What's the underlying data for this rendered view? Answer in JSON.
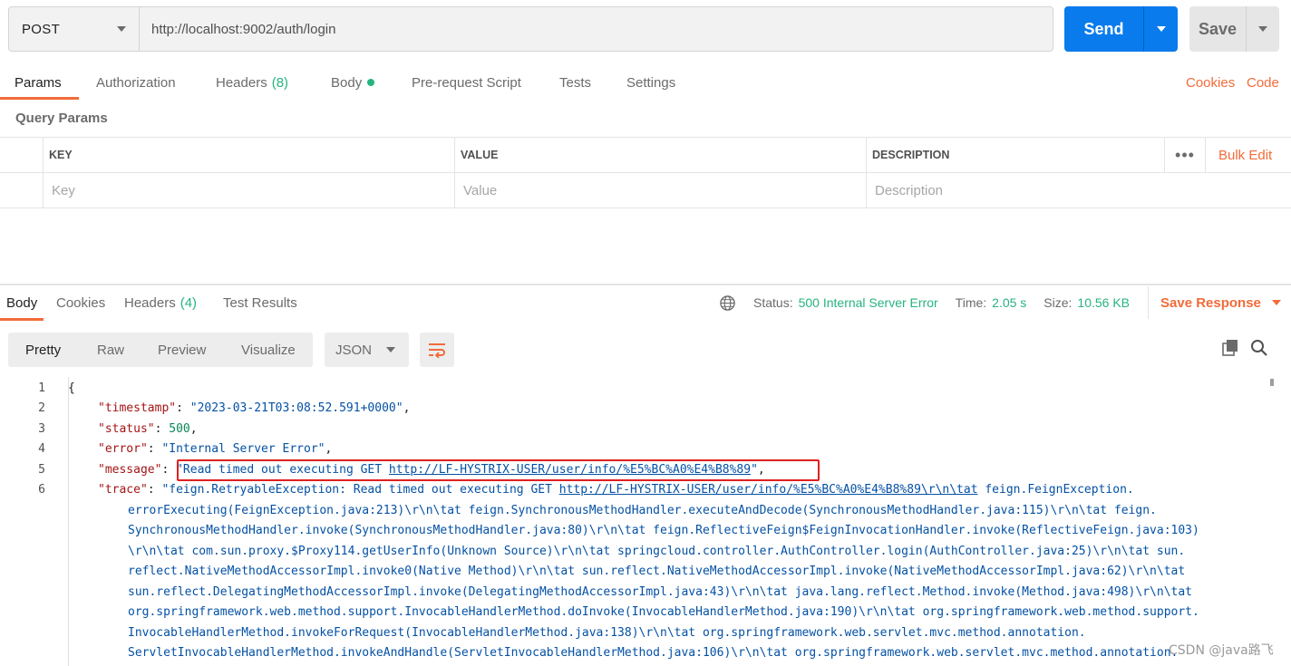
{
  "request": {
    "method": "POST",
    "url": "http://localhost:9002/auth/login",
    "send_label": "Send",
    "save_label": "Save"
  },
  "request_tabs": {
    "params": "Params",
    "authorization": "Authorization",
    "headers": "Headers",
    "headers_count": "(8)",
    "body": "Body",
    "pre_request": "Pre-request Script",
    "tests": "Tests",
    "settings": "Settings",
    "cookies": "Cookies",
    "code": "Code"
  },
  "query_params": {
    "title": "Query Params",
    "columns": [
      "KEY",
      "VALUE",
      "DESCRIPTION"
    ],
    "placeholders": [
      "Key",
      "Value",
      "Description"
    ],
    "more": "•••",
    "bulk_edit": "Bulk Edit"
  },
  "response": {
    "tabs": {
      "body": "Body",
      "cookies": "Cookies",
      "headers": "Headers",
      "headers_count": "(4)",
      "test_results": "Test Results"
    },
    "status_label": "Status:",
    "status_value": "500 Internal Server Error",
    "time_label": "Time:",
    "time_value": "2.05 s",
    "size_label": "Size:",
    "size_value": "10.56 KB",
    "save_response": "Save Response"
  },
  "viewer": {
    "modes": [
      "Pretty",
      "Raw",
      "Preview",
      "Visualize"
    ],
    "active_mode": "Pretty",
    "format": "JSON"
  },
  "code": {
    "line_numbers": [
      "1",
      "2",
      "3",
      "4",
      "5",
      "6"
    ],
    "open_brace": "{",
    "timestamp_key": "\"timestamp\"",
    "timestamp_value": "\"2023-03-21T03:08:52.591+0000\"",
    "status_key": "\"status\"",
    "status_value": "500",
    "error_key": "\"error\"",
    "error_value": "\"Internal Server Error\"",
    "message_key": "\"message\"",
    "message_prefix": "\"Read timed out executing GET ",
    "message_link": "http://LF-HYSTRIX-USER/user/info/%E5%BC%A0%E4%B8%89",
    "message_suffix": "\"",
    "trace_key": "\"trace\"",
    "trace_prefix": "\"feign.RetryableException: Read timed out executing GET ",
    "trace_link": "http://LF-HYSTRIX-USER/user/info/%E5%BC%A0%E4%B8%89\\r\\n\\tat",
    "trace_first_rest": " feign.FeignException.",
    "trace_lines": [
      "errorExecuting(FeignException.java:213)\\r\\n\\tat feign.SynchronousMethodHandler.executeAndDecode(SynchronousMethodHandler.java:115)\\r\\n\\tat feign.",
      "SynchronousMethodHandler.invoke(SynchronousMethodHandler.java:80)\\r\\n\\tat feign.ReflectiveFeign$FeignInvocationHandler.invoke(ReflectiveFeign.java:103)",
      "\\r\\n\\tat com.sun.proxy.$Proxy114.getUserInfo(Unknown Source)\\r\\n\\tat springcloud.controller.AuthController.login(AuthController.java:25)\\r\\n\\tat sun.",
      "reflect.NativeMethodAccessorImpl.invoke0(Native Method)\\r\\n\\tat sun.reflect.NativeMethodAccessorImpl.invoke(NativeMethodAccessorImpl.java:62)\\r\\n\\tat",
      "sun.reflect.DelegatingMethodAccessorImpl.invoke(DelegatingMethodAccessorImpl.java:43)\\r\\n\\tat java.lang.reflect.Method.invoke(Method.java:498)\\r\\n\\tat",
      "org.springframework.web.method.support.InvocableHandlerMethod.doInvoke(InvocableHandlerMethod.java:190)\\r\\n\\tat org.springframework.web.method.support.",
      "InvocableHandlerMethod.invokeForRequest(InvocableHandlerMethod.java:138)\\r\\n\\tat org.springframework.web.servlet.mvc.method.annotation.",
      "ServletInvocableHandlerMethod.invokeAndHandle(ServletInvocableHandlerMethod.java:106)\\r\\n\\tat org.springframework.web.servlet.mvc.method.annotation."
    ]
  },
  "watermark": "CSDN @java路飞",
  "colors": {
    "accent": "#f26b3a",
    "send_blue": "#097bed",
    "status_green": "#26b47f",
    "highlight_red": "#e02020"
  }
}
